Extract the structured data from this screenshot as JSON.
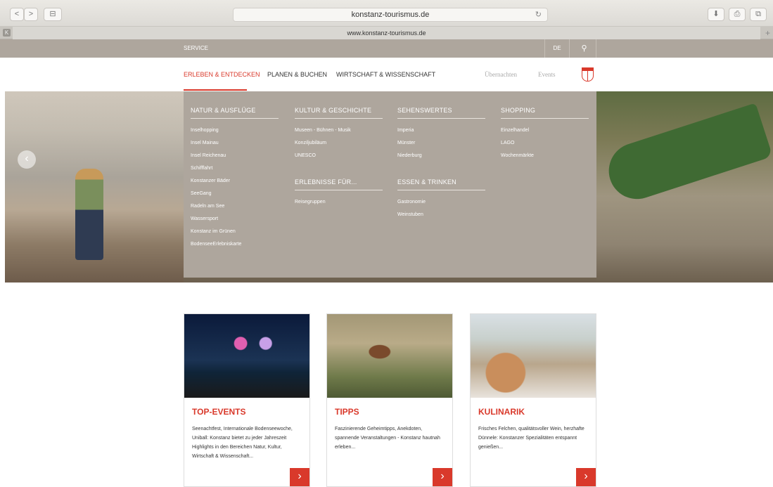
{
  "browser": {
    "url": "konstanz-tourismus.de",
    "tab_title": "www.konstanz-tourismus.de",
    "tab_favicon": "K",
    "back": "<",
    "forward": ">",
    "sidebar": "⊟",
    "reload": "↻",
    "download": "⬇",
    "share": "⎙",
    "tabs": "⧉",
    "new_tab": "+"
  },
  "service_bar": {
    "service": "SERVICE",
    "lang": "DE",
    "search_icon": "⚲"
  },
  "nav": {
    "items": [
      "ERLEBEN & ENTDECKEN",
      "PLANEN & BUCHEN",
      "WIRTSCHAFT & WISSENSCHAFT"
    ],
    "light_items": [
      "Übernachten",
      "Events"
    ]
  },
  "hero": {
    "prev": "‹"
  },
  "mega": {
    "columns": [
      {
        "title": "NATUR & AUSFLÜGE",
        "items": [
          "Inselhopping",
          "Insel Mainau",
          "Insel Reichenau",
          "Schifffahrt",
          "Konstanzer Bäder",
          "SeeGang",
          "Radeln am See",
          "Wassersport",
          "Konstanz im Grünen",
          "BodenseeErlebniskarte"
        ]
      },
      {
        "title": "KULTUR & GESCHICHTE",
        "items": [
          "Museen - Bühnen - Musik",
          "Konziljubiläum",
          "UNESCO"
        ]
      },
      {
        "title": "SEHENSWERTES",
        "items": [
          "Imperia",
          "Münster",
          "Niederburg"
        ]
      },
      {
        "title": "SHOPPING",
        "items": [
          "Einzelhandel",
          "LAGO",
          "Wochenmärkte"
        ]
      }
    ],
    "sub_sections": [
      {
        "title": "ERLEBNISSE FÜR...",
        "items": [
          "Reisegruppen"
        ]
      },
      {
        "title": "ESSEN & TRINKEN",
        "items": [
          "Gastronomie",
          "Weinstuben"
        ]
      }
    ]
  },
  "cards": [
    {
      "title": "TOP-EVENTS",
      "text": "Seenachtfest, Internationale Bodenseewoche, Uniball: Konstanz bietet zu jeder Jahreszeit Highlights in den Bereichen Natur, Kultur, Wirtschaft & Wissenschaft...",
      "arrow": "›"
    },
    {
      "title": "TIPPS",
      "text": "Faszinierende Geheimtipps, Anekdoten, spannende Veranstaltungen - Konstanz hautnah erleben...",
      "arrow": "›"
    },
    {
      "title": "KULINARIK",
      "text": "Frisches Felchen, qualitätsvoller Wein, herzhafte Dünnele: Konstanzer Spezialitäten entspannt genießen...",
      "arrow": "›"
    }
  ]
}
